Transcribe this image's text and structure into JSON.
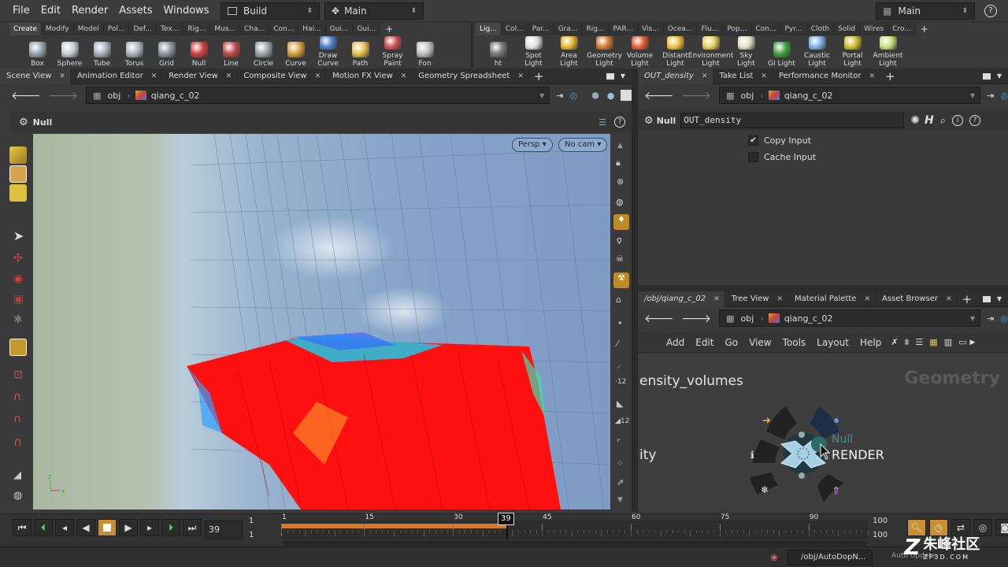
{
  "menubar": {
    "items": [
      "File",
      "Edit",
      "Render",
      "Assets",
      "Windows",
      "Help"
    ],
    "desktop_label": "Build",
    "context_label": "Main",
    "right_label": "Main",
    "help_icon": "help-icon"
  },
  "shelf": {
    "left_tabs": [
      "Create",
      "Modify",
      "Model",
      "Pol...",
      "Def...",
      "Tex...",
      "Rig...",
      "Mus...",
      "Cha...",
      "Con...",
      "Hai...",
      "Gui...",
      "Gui..."
    ],
    "right_tabs": [
      "Lig...",
      "Col...",
      "Par...",
      "Gra...",
      "Rig...",
      "PAR...",
      "Vis...",
      "Ocea...",
      "Flu...",
      "Pop...",
      "Con...",
      "Pyr...",
      "Cloth",
      "Solid",
      "Wires",
      "Cro..."
    ],
    "left_tools": [
      {
        "label": "Box",
        "color": "#9aa4ae"
      },
      {
        "label": "Sphere",
        "color": "#c8ccd2"
      },
      {
        "label": "Tube",
        "color": "#aab2bc"
      },
      {
        "label": "Torus",
        "color": "#b0b6bd"
      },
      {
        "label": "Grid",
        "color": "#8f959c"
      },
      {
        "label": "Null",
        "color": "#d04040"
      },
      {
        "label": "Line",
        "color": "#c04848"
      },
      {
        "label": "Circle",
        "color": "#a0a6ac"
      },
      {
        "label": "Curve",
        "color": "#d6a23a"
      },
      {
        "label": "Draw Curve",
        "color": "#4f7fc8"
      },
      {
        "label": "Path",
        "color": "#e8c050"
      },
      {
        "label": "Spray Paint",
        "color": "#d05050"
      },
      {
        "label": "Fon",
        "color": "#c0c0c0"
      }
    ],
    "right_tools": [
      {
        "label": "ht",
        "color": "#777"
      },
      {
        "label": "Spot Light",
        "color": "#e0e0e0"
      },
      {
        "label": "Area Light",
        "color": "#e6b830"
      },
      {
        "label": "Geometry Light",
        "color": "#d87a30"
      },
      {
        "label": "Volume Light",
        "color": "#e06030"
      },
      {
        "label": "Distant Light",
        "color": "#f0c040"
      },
      {
        "label": "Environment Light",
        "color": "#e8d060"
      },
      {
        "label": "Sky Light",
        "color": "#e0e0c0"
      },
      {
        "label": "GI Light",
        "color": "#40a040"
      },
      {
        "label": "Caustic Light",
        "color": "#80b0e0"
      },
      {
        "label": "Portal Light",
        "color": "#d0c030"
      },
      {
        "label": "Ambient Light",
        "color": "#c8e080"
      }
    ]
  },
  "left_pane": {
    "tabs": [
      "Scene View",
      "Animation Editor",
      "Render View",
      "Composite View",
      "Motion FX View",
      "Geometry Spreadsheet"
    ],
    "path_root": "obj",
    "path_node": "qiang_c_02",
    "operator_label": "Null",
    "viewport": {
      "persp_label": "Persp",
      "cam_label": "No cam"
    }
  },
  "params_pane": {
    "tabs": [
      "OUT_density",
      "Take List",
      "Performance Monitor"
    ],
    "path_root": "obj",
    "path_node": "qiang_c_02",
    "node_type": "Null",
    "node_name": "OUT_density",
    "params": [
      {
        "label": "Copy Input",
        "checked": true
      },
      {
        "label": "Cache Input",
        "checked": false
      }
    ]
  },
  "network_pane": {
    "tabs": [
      "/obj/qiang_c_02",
      "Tree View",
      "Material Palette",
      "Asset Browser"
    ],
    "path_root": "obj",
    "path_node": "qiang_c_02",
    "menu": [
      "Add",
      "Edit",
      "Go",
      "View",
      "Tools",
      "Layout",
      "Help"
    ],
    "context_label": "Geometry",
    "node_left_label_1": "ensity_volumes",
    "node_left_label_2": "ity",
    "node_type": "Null",
    "node_name": "RENDER"
  },
  "timeline": {
    "current_frame": "39",
    "start_frame": "1",
    "start_frame_2": "1",
    "end_frame": "100",
    "end_frame_2": "100",
    "ticks": [
      "1",
      "15",
      "30",
      "45",
      "60",
      "75",
      "90"
    ],
    "range": [
      1,
      100
    ],
    "marker_frame": "39"
  },
  "statusbar": {
    "path_text": "/obj/AutoDopN...",
    "update_mode": "Auto Update",
    "watermark": "朱峰社区",
    "watermark_sub": "ZF3D.COM"
  }
}
